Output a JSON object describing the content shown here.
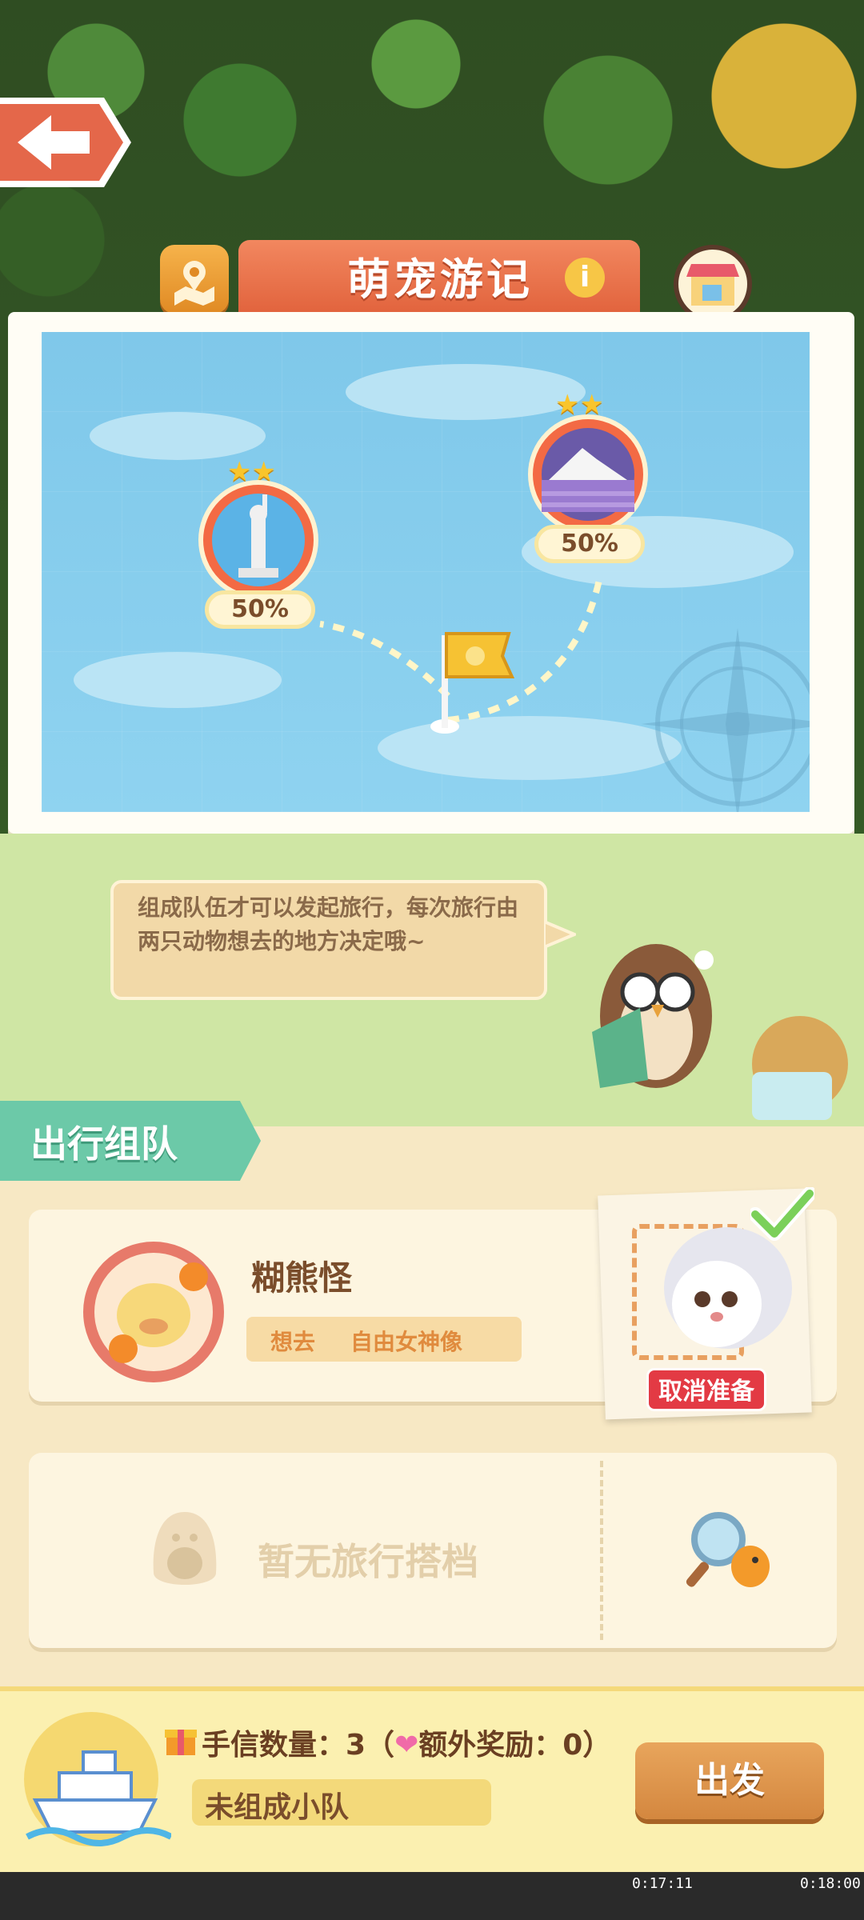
{
  "header": {
    "title": "萌宠游记",
    "info_icon": "i"
  },
  "map": {
    "destinations": [
      {
        "name": "自由女神像",
        "progress_text": "50%",
        "stars": 2
      },
      {
        "name": "mountain-lavender",
        "progress_text": "50%",
        "stars": 2
      }
    ]
  },
  "tip": {
    "text": "组成队伍才可以发起旅行，每次旅行由两只动物想去的地方决定哦~"
  },
  "team": {
    "header": "出行组队",
    "pet": {
      "name": "糊熊怪",
      "wants_label": "想去",
      "wants_value": "自由女神像"
    },
    "cancel_ready": "取消准备",
    "empty_partner": "暂无旅行搭档"
  },
  "bottom": {
    "letters_text": "手信数量：3（",
    "bonus_text": "额外奖励：0）",
    "status": "未组成小队",
    "depart": "出发"
  },
  "timers": [
    "0:17:11",
    "0:18:00"
  ],
  "colors": {
    "accent": "#e0603a",
    "sea": "#8fd3f0",
    "team_header": "#6cc9a8",
    "depart": "#d4873f"
  }
}
